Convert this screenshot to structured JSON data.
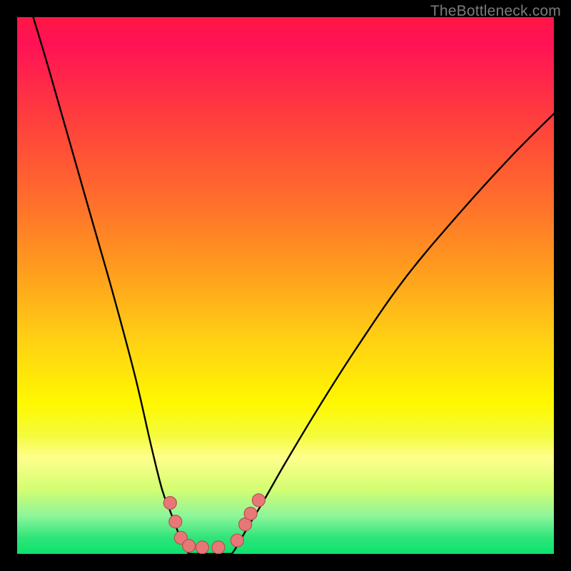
{
  "watermark": "TheBottleneck.com",
  "chart_data": {
    "type": "line",
    "title": "",
    "xlabel": "",
    "ylabel": "",
    "xlim": [
      0,
      100
    ],
    "ylim": [
      0,
      100
    ],
    "grid": false,
    "legend": false,
    "series": [
      {
        "name": "left-branch",
        "x": [
          3,
          6,
          10,
          14,
          18,
          22,
          25,
          27,
          28.5,
          30,
          31,
          32
        ],
        "y": [
          100,
          90,
          76,
          62,
          48,
          33,
          20,
          12,
          8,
          4,
          1.5,
          0
        ]
      },
      {
        "name": "right-branch",
        "x": [
          40,
          41,
          43,
          46,
          50,
          56,
          63,
          72,
          82,
          92,
          100
        ],
        "y": [
          0,
          1.5,
          5,
          10,
          17,
          27,
          38,
          51,
          63,
          74,
          82
        ]
      },
      {
        "name": "floor",
        "x": [
          32,
          40
        ],
        "y": [
          0,
          0
        ]
      }
    ],
    "markers": [
      {
        "name": "cluster-left-1",
        "x": 28.5,
        "y": 9.5
      },
      {
        "name": "cluster-left-2",
        "x": 29.5,
        "y": 6
      },
      {
        "name": "cluster-left-3",
        "x": 30.5,
        "y": 3
      },
      {
        "name": "cluster-floor-1",
        "x": 32,
        "y": 1.5
      },
      {
        "name": "cluster-floor-2",
        "x": 34.5,
        "y": 1.2
      },
      {
        "name": "cluster-floor-3",
        "x": 37.5,
        "y": 1.2
      },
      {
        "name": "cluster-right-1",
        "x": 41,
        "y": 2.5
      },
      {
        "name": "cluster-right-2",
        "x": 42.5,
        "y": 5.5
      },
      {
        "name": "cluster-right-3",
        "x": 43.5,
        "y": 7.5
      },
      {
        "name": "cluster-right-4",
        "x": 45,
        "y": 10
      }
    ],
    "colors": {
      "curve": "#000000",
      "marker_fill": "#e87878",
      "marker_stroke": "#b94f4f",
      "gradient_top": "#ff1744",
      "gradient_mid": "#fff800",
      "gradient_bottom": "#0be36c",
      "frame": "#000000"
    }
  }
}
